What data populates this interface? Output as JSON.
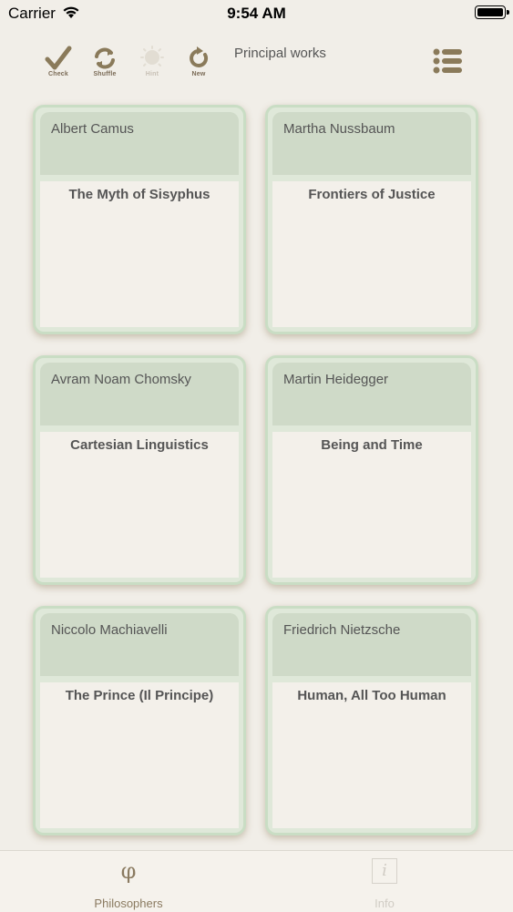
{
  "status": {
    "carrier": "Carrier",
    "time": "9:54 AM"
  },
  "toolbar": {
    "check_label": "Check",
    "shuffle_label": "Shuffle",
    "hint_label": "Hint",
    "new_label": "New",
    "title": "Principal works"
  },
  "cards": [
    {
      "name": "Albert Camus",
      "work": "The Myth of Sisyphus"
    },
    {
      "name": "Martha Nussbaum",
      "work": "Frontiers of Justice"
    },
    {
      "name": "Avram Noam Chomsky",
      "work": "Cartesian Linguistics"
    },
    {
      "name": "Martin Heidegger",
      "work": "Being and Time"
    },
    {
      "name": "Niccolo Machiavelli",
      "work": "The Prince (Il Principe)"
    },
    {
      "name": "Friedrich Nietzsche",
      "work": "Human, All Too Human"
    }
  ],
  "tabs": [
    {
      "label": "Philosophers",
      "icon": "φ",
      "active": true
    },
    {
      "label": "Info",
      "icon": "i",
      "active": false
    }
  ],
  "colors": {
    "accent": "#8a7a60",
    "card_border": "#c9ddc4",
    "background": "#f1eee8"
  }
}
